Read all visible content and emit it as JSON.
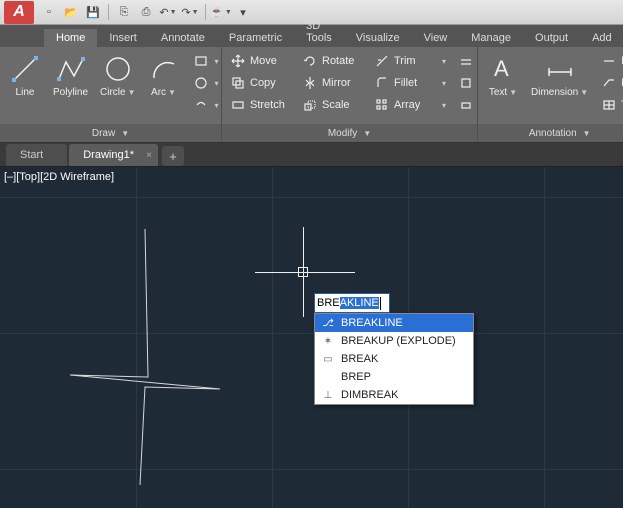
{
  "app": {
    "logo_letter": "A"
  },
  "qat": {
    "items": [
      {
        "name": "new-icon",
        "glyph": "▫"
      },
      {
        "name": "open-icon",
        "glyph": "📂"
      },
      {
        "name": "save-icon",
        "glyph": "💾"
      },
      {
        "name": "saveas-icon",
        "glyph": "⎘"
      },
      {
        "name": "print-icon",
        "glyph": "⎙"
      },
      {
        "name": "undo-icon",
        "glyph": "↶"
      },
      {
        "name": "redo-icon",
        "glyph": "↷"
      },
      {
        "name": "teapot-icon",
        "glyph": "☕"
      }
    ]
  },
  "ribbon_tabs": [
    "Home",
    "Insert",
    "Annotate",
    "Parametric",
    "3D Tools",
    "Visualize",
    "View",
    "Manage",
    "Output",
    "Add"
  ],
  "active_ribbon_tab": "Home",
  "panels": {
    "draw": {
      "title": "Draw",
      "buttons": [
        {
          "name": "line-button",
          "label": "Line"
        },
        {
          "name": "polyline-button",
          "label": "Polyline"
        },
        {
          "name": "circle-button",
          "label": "Circle"
        },
        {
          "name": "arc-button",
          "label": "Arc"
        }
      ]
    },
    "modify": {
      "title": "Modify",
      "rows": [
        [
          {
            "name": "move-button",
            "label": "Move"
          },
          {
            "name": "rotate-button",
            "label": "Rotate"
          },
          {
            "name": "trim-button",
            "label": "Trim"
          }
        ],
        [
          {
            "name": "copy-button",
            "label": "Copy"
          },
          {
            "name": "mirror-button",
            "label": "Mirror"
          },
          {
            "name": "fillet-button",
            "label": "Fillet"
          }
        ],
        [
          {
            "name": "stretch-button",
            "label": "Stretch"
          },
          {
            "name": "scale-button",
            "label": "Scale"
          },
          {
            "name": "array-button",
            "label": "Array"
          }
        ]
      ]
    },
    "annotation": {
      "title": "Annotation",
      "buttons": [
        {
          "name": "text-button",
          "label": "Text"
        },
        {
          "name": "dimension-button",
          "label": "Dimension"
        }
      ],
      "side": [
        {
          "name": "linear-button",
          "label": "Li"
        },
        {
          "name": "leader-button",
          "label": "Le"
        },
        {
          "name": "table-button",
          "label": "Ta"
        }
      ]
    }
  },
  "doc_tabs": [
    {
      "label": "Start",
      "active": false
    },
    {
      "label": "Drawing1*",
      "active": true
    }
  ],
  "viewport": {
    "label": "[–][Top][2D Wireframe]"
  },
  "command_input": {
    "typed": "BRE",
    "completion": "AKLINE"
  },
  "autocomplete": {
    "items": [
      {
        "label": "BREAKLINE",
        "icon": "⎇",
        "selected": true
      },
      {
        "label": "BREAKUP (EXPLODE)",
        "icon": "✶",
        "selected": false
      },
      {
        "label": "BREAK",
        "icon": "▭",
        "selected": false
      },
      {
        "label": "BREP",
        "icon": "",
        "selected": false
      },
      {
        "label": "DIMBREAK",
        "icon": "⊥",
        "selected": false
      }
    ]
  }
}
